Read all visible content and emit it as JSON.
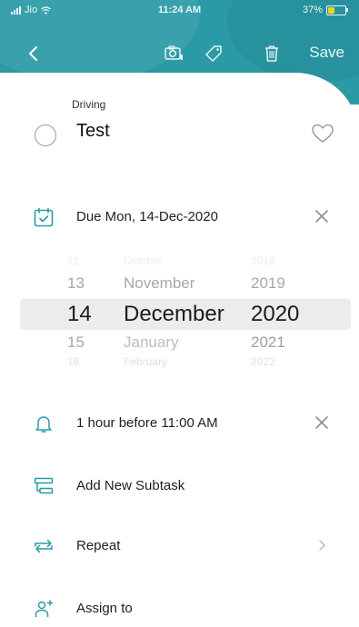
{
  "status": {
    "carrier": "Jio",
    "time": "11:24 AM",
    "battery": "37%",
    "battery_level": 0.37
  },
  "toolbar": {
    "save_label": "Save"
  },
  "task": {
    "category": "Driving",
    "title": "Test"
  },
  "due": {
    "label": "Due Mon, 14-Dec-2020"
  },
  "picker": {
    "days": [
      "12",
      "13",
      "14",
      "15",
      "16"
    ],
    "months": [
      "October",
      "November",
      "December",
      "January",
      "February"
    ],
    "years": [
      "2018",
      "2019",
      "2020",
      "2021",
      "2022"
    ]
  },
  "reminder": {
    "label": "1 hour before 11:00 AM"
  },
  "rows": {
    "subtask": "Add New Subtask",
    "repeat": "Repeat",
    "assign": "Assign to"
  },
  "colors": {
    "accent": "#2a9aa6",
    "battery": "#f2d21b"
  }
}
